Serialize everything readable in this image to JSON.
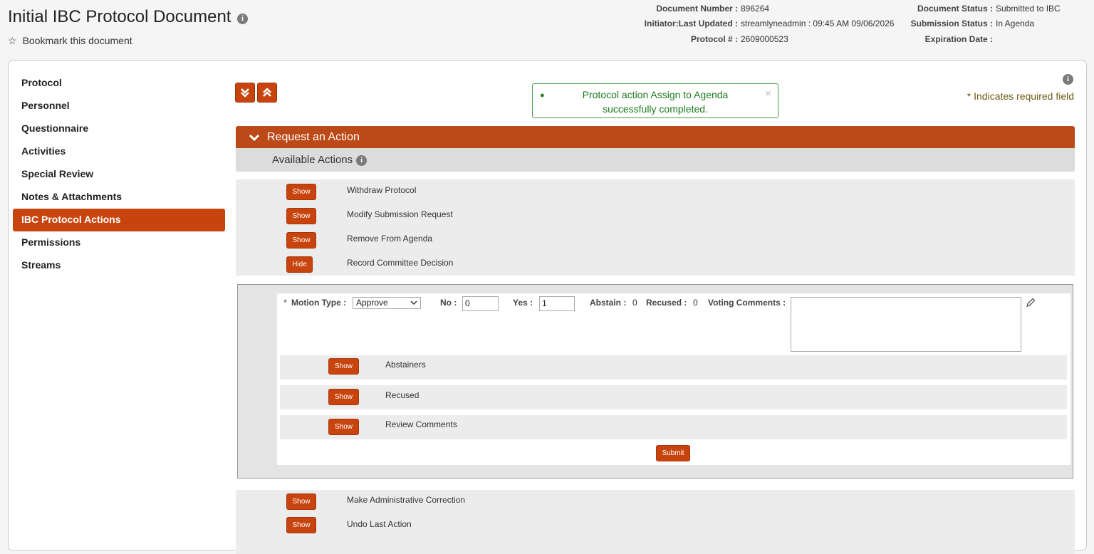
{
  "header": {
    "title": "Initial IBC Protocol Document",
    "bookmark_label": "Bookmark this document",
    "document_number_label": "Document Number :",
    "document_number": "896264",
    "initiator_label": "Initiator:Last Updated :",
    "initiator_value": "streamlyneadmin : 09:45 AM 09/06/2026",
    "protocol_label": "Protocol # :",
    "protocol_value": "2609000523",
    "doc_status_label": "Document Status :",
    "doc_status": "Submitted to IBC",
    "submission_status_label": "Submission Status :",
    "submission_status": "In Agenda",
    "expiration_label": "Expiration Date :",
    "expiration_value": ""
  },
  "sidebar": {
    "items": [
      {
        "label": "Protocol"
      },
      {
        "label": "Personnel"
      },
      {
        "label": "Questionnaire"
      },
      {
        "label": "Activities"
      },
      {
        "label": "Special Review"
      },
      {
        "label": "Notes & Attachments"
      },
      {
        "label": "IBC Protocol Actions",
        "active": true
      },
      {
        "label": "Permissions"
      },
      {
        "label": "Streams"
      }
    ]
  },
  "message": {
    "text_line1": "Protocol action Assign to Agenda",
    "text_line2": "successfully completed.",
    "close": "×"
  },
  "required_note": "* Indicates required field",
  "section": {
    "title": "Request an Action",
    "subtitle": "Available Actions"
  },
  "actions": [
    {
      "button": "Show",
      "label": "Withdraw Protocol"
    },
    {
      "button": "Show",
      "label": "Modify Submission Request"
    },
    {
      "button": "Show",
      "label": "Remove From Agenda"
    },
    {
      "button": "Hide",
      "label": "Record Committee Decision"
    }
  ],
  "decision": {
    "required_star": "*",
    "motion_type_label": "Motion Type :",
    "motion_type_value": "Approve",
    "no_label": "No :",
    "no_value": "0",
    "yes_label": "Yes :",
    "yes_value": "1",
    "abstain_label": "Abstain :",
    "abstain_value": "0",
    "recused_label": "Recused :",
    "recused_value": "0",
    "voting_comments_label": "Voting Comments :",
    "subrows": [
      {
        "button": "Show",
        "label": "Abstainers"
      },
      {
        "button": "Show",
        "label": "Recused"
      },
      {
        "button": "Show",
        "label": "Review Comments"
      }
    ],
    "submit_label": "Submit"
  },
  "bottom_actions": [
    {
      "button": "Show",
      "label": "Make Administrative Correction"
    },
    {
      "button": "Show",
      "label": "Undo Last Action"
    }
  ],
  "colors": {
    "accent": "#c8440e",
    "section_bar": "#bb4a18",
    "success": "#1f7a1f"
  }
}
